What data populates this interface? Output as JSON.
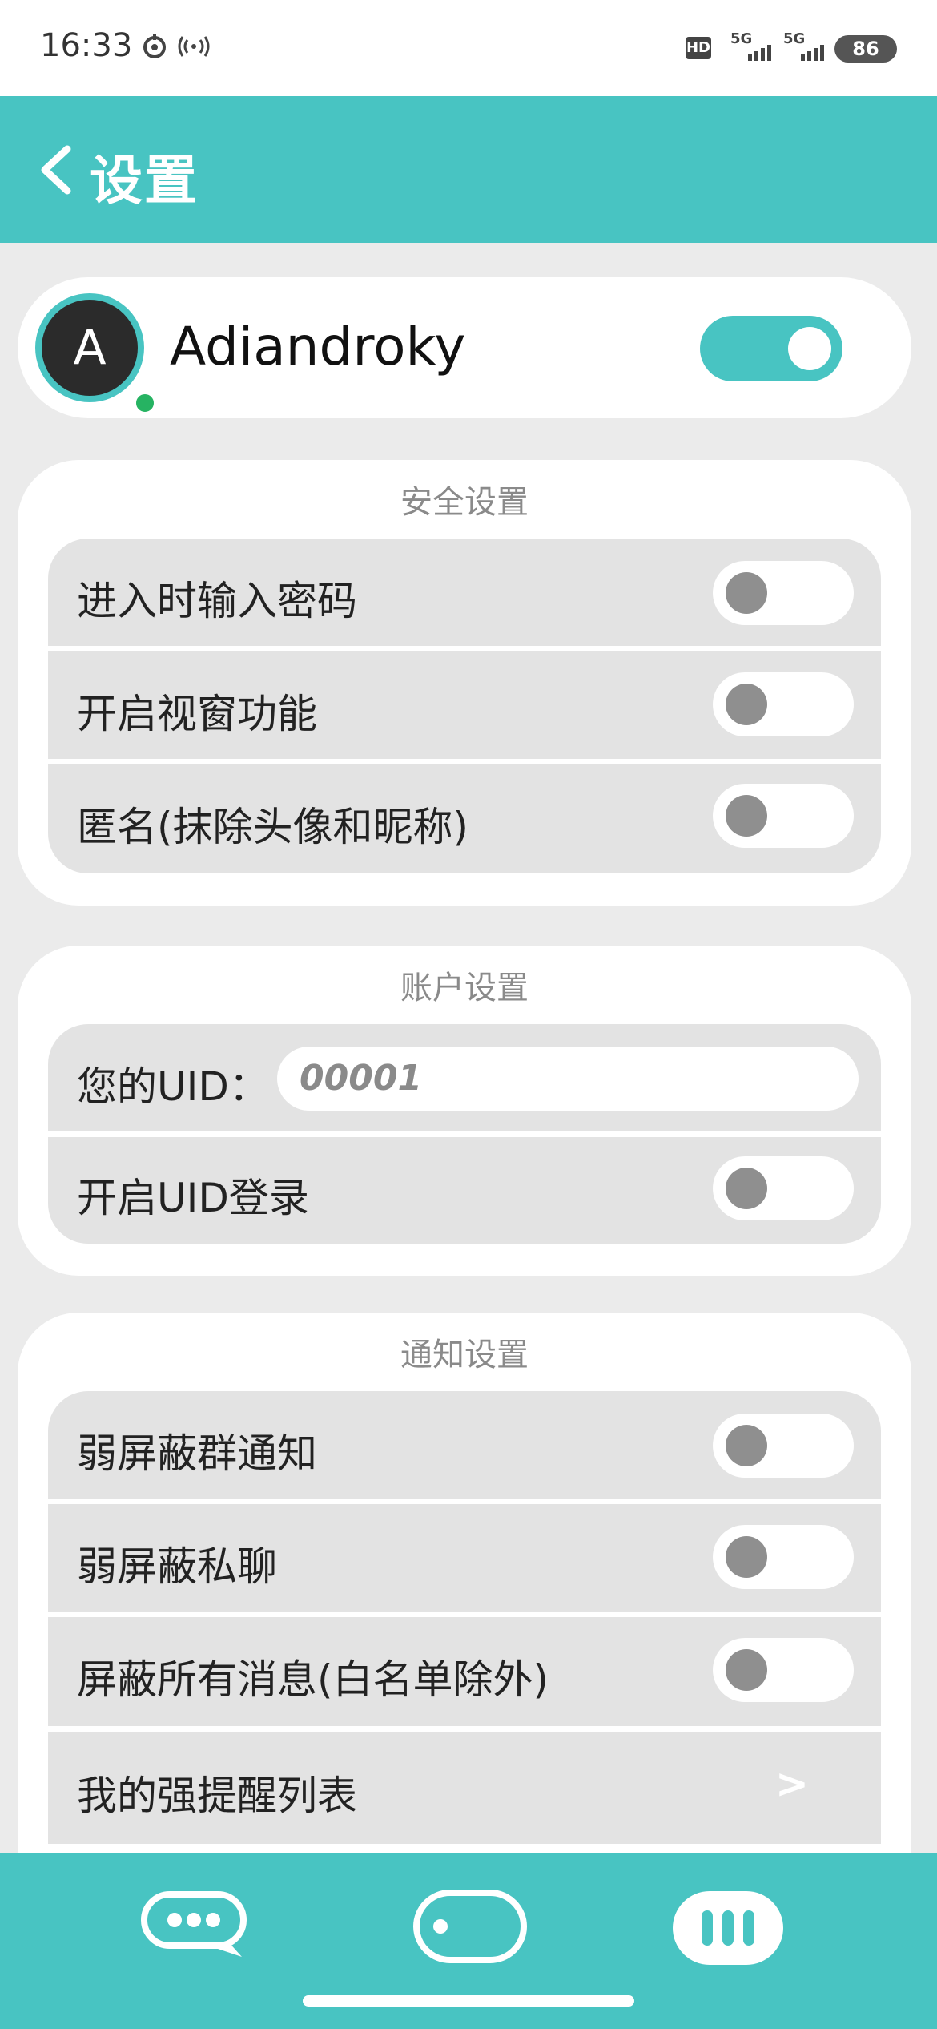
{
  "status_bar": {
    "time": "16:33",
    "hd": "HD",
    "signal1": "5G",
    "signal2": "5G",
    "battery": "86",
    "icons": [
      "notification-icon",
      "hotspot-icon"
    ]
  },
  "header": {
    "title": "设置",
    "back_icon": "chevron-left-icon"
  },
  "profile": {
    "avatar_letter": "A",
    "username": "Adiandroky",
    "enabled": true
  },
  "security": {
    "title": "安全设置",
    "items": [
      {
        "label": "进入时输入密码",
        "on": false
      },
      {
        "label": "开启视窗功能",
        "on": false
      },
      {
        "label": "匿名(抹除头像和昵称)",
        "on": false
      }
    ]
  },
  "account": {
    "title": "账户设置",
    "uid_label": "您的UID：",
    "uid_value": "00001",
    "uid_login_label": "开启UID登录",
    "uid_login_on": false
  },
  "notifications": {
    "title": "通知设置",
    "items": [
      {
        "label": "弱屏蔽群通知",
        "on": false
      },
      {
        "label": "弱屏蔽私聊",
        "on": false
      },
      {
        "label": "屏蔽所有消息(白名单除外)",
        "on": false
      }
    ],
    "reminder_label": "我的强提醒列表",
    "reminder_chevron": ">"
  },
  "bottom_nav": {
    "items": [
      "chat-bubble-icon",
      "toggle-pill-icon",
      "menu-bars-icon"
    ]
  },
  "colors": {
    "accent": "#48c4c2",
    "online": "#26b362",
    "background": "#ebebeb",
    "row": "#e3e3e3"
  }
}
